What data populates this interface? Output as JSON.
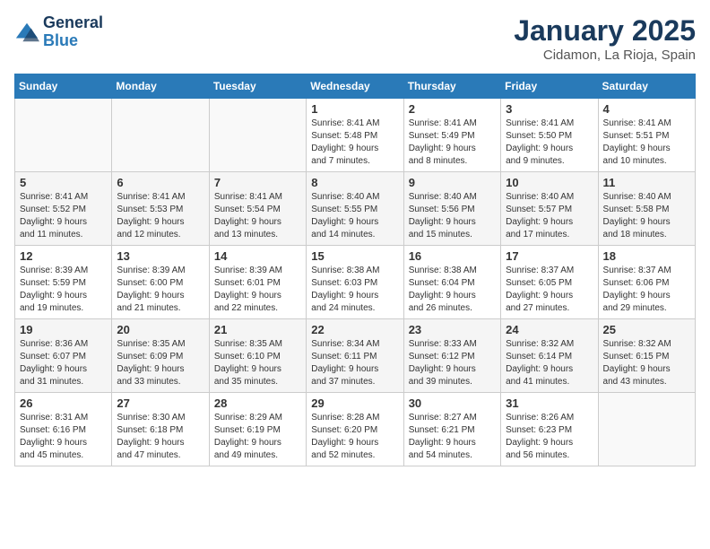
{
  "header": {
    "logo_line1": "General",
    "logo_line2": "Blue",
    "month": "January 2025",
    "location": "Cidamon, La Rioja, Spain"
  },
  "weekdays": [
    "Sunday",
    "Monday",
    "Tuesday",
    "Wednesday",
    "Thursday",
    "Friday",
    "Saturday"
  ],
  "weeks": [
    [
      {
        "day": "",
        "info": ""
      },
      {
        "day": "",
        "info": ""
      },
      {
        "day": "",
        "info": ""
      },
      {
        "day": "1",
        "info": "Sunrise: 8:41 AM\nSunset: 5:48 PM\nDaylight: 9 hours\nand 7 minutes."
      },
      {
        "day": "2",
        "info": "Sunrise: 8:41 AM\nSunset: 5:49 PM\nDaylight: 9 hours\nand 8 minutes."
      },
      {
        "day": "3",
        "info": "Sunrise: 8:41 AM\nSunset: 5:50 PM\nDaylight: 9 hours\nand 9 minutes."
      },
      {
        "day": "4",
        "info": "Sunrise: 8:41 AM\nSunset: 5:51 PM\nDaylight: 9 hours\nand 10 minutes."
      }
    ],
    [
      {
        "day": "5",
        "info": "Sunrise: 8:41 AM\nSunset: 5:52 PM\nDaylight: 9 hours\nand 11 minutes."
      },
      {
        "day": "6",
        "info": "Sunrise: 8:41 AM\nSunset: 5:53 PM\nDaylight: 9 hours\nand 12 minutes."
      },
      {
        "day": "7",
        "info": "Sunrise: 8:41 AM\nSunset: 5:54 PM\nDaylight: 9 hours\nand 13 minutes."
      },
      {
        "day": "8",
        "info": "Sunrise: 8:40 AM\nSunset: 5:55 PM\nDaylight: 9 hours\nand 14 minutes."
      },
      {
        "day": "9",
        "info": "Sunrise: 8:40 AM\nSunset: 5:56 PM\nDaylight: 9 hours\nand 15 minutes."
      },
      {
        "day": "10",
        "info": "Sunrise: 8:40 AM\nSunset: 5:57 PM\nDaylight: 9 hours\nand 17 minutes."
      },
      {
        "day": "11",
        "info": "Sunrise: 8:40 AM\nSunset: 5:58 PM\nDaylight: 9 hours\nand 18 minutes."
      }
    ],
    [
      {
        "day": "12",
        "info": "Sunrise: 8:39 AM\nSunset: 5:59 PM\nDaylight: 9 hours\nand 19 minutes."
      },
      {
        "day": "13",
        "info": "Sunrise: 8:39 AM\nSunset: 6:00 PM\nDaylight: 9 hours\nand 21 minutes."
      },
      {
        "day": "14",
        "info": "Sunrise: 8:39 AM\nSunset: 6:01 PM\nDaylight: 9 hours\nand 22 minutes."
      },
      {
        "day": "15",
        "info": "Sunrise: 8:38 AM\nSunset: 6:03 PM\nDaylight: 9 hours\nand 24 minutes."
      },
      {
        "day": "16",
        "info": "Sunrise: 8:38 AM\nSunset: 6:04 PM\nDaylight: 9 hours\nand 26 minutes."
      },
      {
        "day": "17",
        "info": "Sunrise: 8:37 AM\nSunset: 6:05 PM\nDaylight: 9 hours\nand 27 minutes."
      },
      {
        "day": "18",
        "info": "Sunrise: 8:37 AM\nSunset: 6:06 PM\nDaylight: 9 hours\nand 29 minutes."
      }
    ],
    [
      {
        "day": "19",
        "info": "Sunrise: 8:36 AM\nSunset: 6:07 PM\nDaylight: 9 hours\nand 31 minutes."
      },
      {
        "day": "20",
        "info": "Sunrise: 8:35 AM\nSunset: 6:09 PM\nDaylight: 9 hours\nand 33 minutes."
      },
      {
        "day": "21",
        "info": "Sunrise: 8:35 AM\nSunset: 6:10 PM\nDaylight: 9 hours\nand 35 minutes."
      },
      {
        "day": "22",
        "info": "Sunrise: 8:34 AM\nSunset: 6:11 PM\nDaylight: 9 hours\nand 37 minutes."
      },
      {
        "day": "23",
        "info": "Sunrise: 8:33 AM\nSunset: 6:12 PM\nDaylight: 9 hours\nand 39 minutes."
      },
      {
        "day": "24",
        "info": "Sunrise: 8:32 AM\nSunset: 6:14 PM\nDaylight: 9 hours\nand 41 minutes."
      },
      {
        "day": "25",
        "info": "Sunrise: 8:32 AM\nSunset: 6:15 PM\nDaylight: 9 hours\nand 43 minutes."
      }
    ],
    [
      {
        "day": "26",
        "info": "Sunrise: 8:31 AM\nSunset: 6:16 PM\nDaylight: 9 hours\nand 45 minutes."
      },
      {
        "day": "27",
        "info": "Sunrise: 8:30 AM\nSunset: 6:18 PM\nDaylight: 9 hours\nand 47 minutes."
      },
      {
        "day": "28",
        "info": "Sunrise: 8:29 AM\nSunset: 6:19 PM\nDaylight: 9 hours\nand 49 minutes."
      },
      {
        "day": "29",
        "info": "Sunrise: 8:28 AM\nSunset: 6:20 PM\nDaylight: 9 hours\nand 52 minutes."
      },
      {
        "day": "30",
        "info": "Sunrise: 8:27 AM\nSunset: 6:21 PM\nDaylight: 9 hours\nand 54 minutes."
      },
      {
        "day": "31",
        "info": "Sunrise: 8:26 AM\nSunset: 6:23 PM\nDaylight: 9 hours\nand 56 minutes."
      },
      {
        "day": "",
        "info": ""
      }
    ]
  ]
}
